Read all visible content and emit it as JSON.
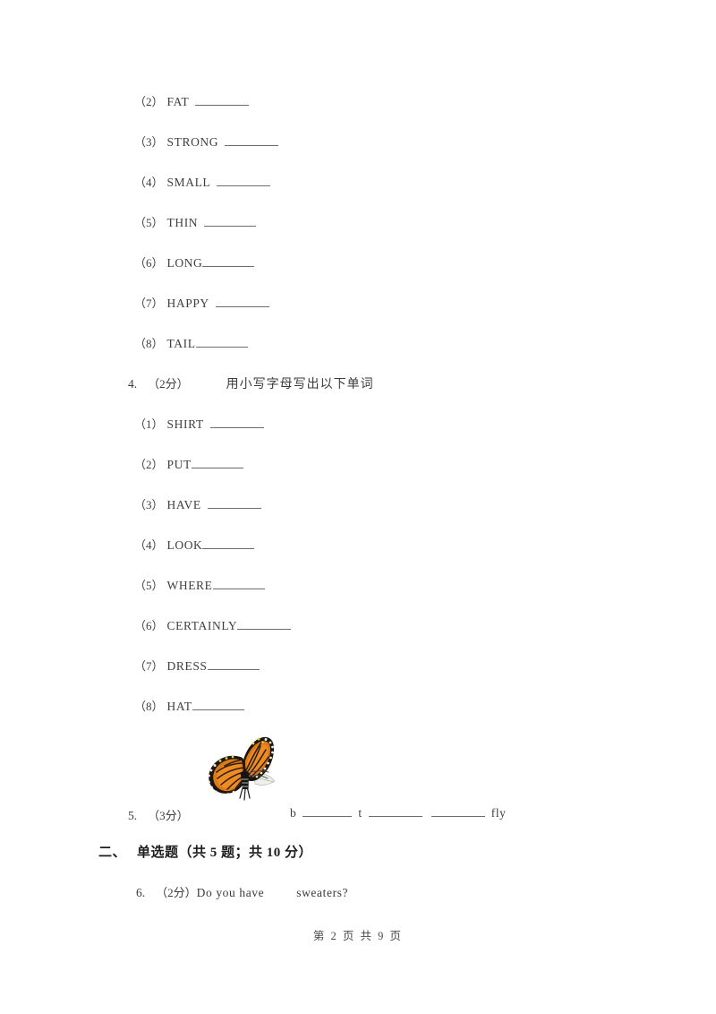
{
  "document": {
    "type": "exam-worksheet",
    "page_footer": "第 2 页 共 9 页",
    "text_color": "#3b3b3b"
  },
  "question3_items": [
    {
      "label": "（2）",
      "word": "FAT",
      "blank_width": 60,
      "gap": "space"
    },
    {
      "label": "（3）",
      "word": "STRONG",
      "blank_width": 60,
      "gap": "space"
    },
    {
      "label": "（4）",
      "word": "SMALL",
      "blank_width": 60,
      "gap": "space"
    },
    {
      "label": "（5）",
      "word": "THIN",
      "blank_width": 58,
      "gap": "space"
    },
    {
      "label": "（6）",
      "word": "LONG",
      "blank_width": 58,
      "gap": "none"
    },
    {
      "label": "（7）",
      "word": "HAPPY",
      "blank_width": 60,
      "gap": "space"
    },
    {
      "label": "（8）",
      "word": "TAIL",
      "blank_width": 58,
      "gap": "none"
    }
  ],
  "question4": {
    "number": "4.",
    "score": "（2分）",
    "prompt": "用小写字母写出以下单词",
    "items": [
      {
        "label": "（1）",
        "word": "SHIRT",
        "blank_width": 60,
        "gap": "space"
      },
      {
        "label": "（2）",
        "word": "PUT",
        "blank_width": 58,
        "gap": "none"
      },
      {
        "label": "（3）",
        "word": "HAVE",
        "blank_width": 60,
        "gap": "space"
      },
      {
        "label": "（4）",
        "word": "LOOK",
        "blank_width": 58,
        "gap": "none"
      },
      {
        "label": "（5）",
        "word": "WHERE",
        "blank_width": 58,
        "gap": "none"
      },
      {
        "label": "（6）",
        "word": "CERTAINLY",
        "blank_width": 60,
        "gap": "none"
      },
      {
        "label": "（7）",
        "word": "DRESS",
        "blank_width": 58,
        "gap": "none"
      },
      {
        "label": "（8）",
        "word": "HAT",
        "blank_width": 58,
        "gap": "none"
      }
    ]
  },
  "question5": {
    "number": "5.",
    "score": "（3分）",
    "image_alt": "monarch-butterfly",
    "answer_line": {
      "letter1": "b",
      "letter2": "t",
      "word_end": "fly"
    }
  },
  "section2": {
    "index": "二、",
    "title": "单选题（共 5 题；共 10 分）"
  },
  "question6": {
    "number": "6.",
    "score": "（2分）",
    "text_before": "Do you have",
    "text_after": "sweaters?"
  },
  "butterfly_colors": {
    "orange_light": "#ED8B25",
    "orange": "#DD7A18",
    "orange_dark": "#C06412",
    "black": "#1c1510",
    "vein": "#2a1d12",
    "spot": "#f2efe6",
    "spot_yellow": "#e8d54a",
    "body": "#141414",
    "hindwing_pale": "#efefe9"
  }
}
